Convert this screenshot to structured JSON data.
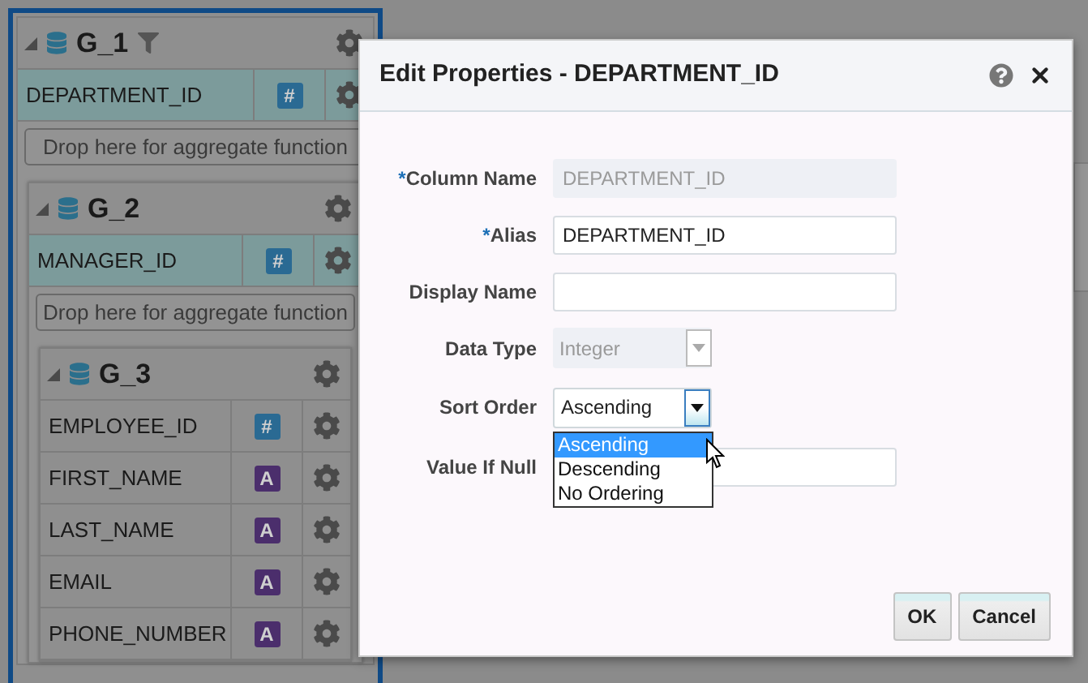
{
  "groups": [
    {
      "title": "G_1",
      "expanded": true,
      "filter": true,
      "fields": [
        {
          "name": "DEPARTMENT_ID",
          "kind": "number",
          "badge": "#",
          "highlighted": true
        }
      ],
      "drop_hint": "Drop here for aggregate function",
      "children": [
        {
          "title": "G_2",
          "expanded": true,
          "filter": false,
          "fields": [
            {
              "name": "MANAGER_ID",
              "kind": "number",
              "badge": "#",
              "highlighted": true
            }
          ],
          "drop_hint": "Drop here for aggregate function",
          "children": [
            {
              "title": "G_3",
              "expanded": true,
              "filter": false,
              "fields": [
                {
                  "name": "EMPLOYEE_ID",
                  "kind": "number",
                  "badge": "#",
                  "highlighted": false
                },
                {
                  "name": "FIRST_NAME",
                  "kind": "text",
                  "badge": "A",
                  "highlighted": false
                },
                {
                  "name": "LAST_NAME",
                  "kind": "text",
                  "badge": "A",
                  "highlighted": false
                },
                {
                  "name": "EMAIL",
                  "kind": "text",
                  "badge": "A",
                  "highlighted": false
                },
                {
                  "name": "PHONE_NUMBER",
                  "kind": "text",
                  "badge": "A",
                  "highlighted": false
                }
              ]
            }
          ]
        }
      ]
    }
  ],
  "dialog": {
    "title": "Edit Properties - DEPARTMENT_ID",
    "fields": [
      {
        "label": "Column Name",
        "required_mark": "*",
        "kind": "readonly",
        "value": "DEPARTMENT_ID"
      },
      {
        "label": "Alias",
        "required_mark": "*",
        "kind": "text",
        "value": "DEPARTMENT_ID"
      },
      {
        "label": "Display Name",
        "kind": "text"
      },
      {
        "label": "Data Type",
        "kind": "select",
        "disabled": true,
        "value": "Integer"
      },
      {
        "label": "Sort Order",
        "kind": "select",
        "disabled": false,
        "expanded": true,
        "value": "Ascending",
        "options": [
          {
            "label": "Ascending",
            "selected": true
          },
          {
            "label": "Descending",
            "selected": false
          },
          {
            "label": "No Ordering",
            "selected": false
          }
        ]
      },
      {
        "label": "Value If Null",
        "kind": "text"
      }
    ],
    "buttons": [
      "OK",
      "Cancel"
    ]
  }
}
